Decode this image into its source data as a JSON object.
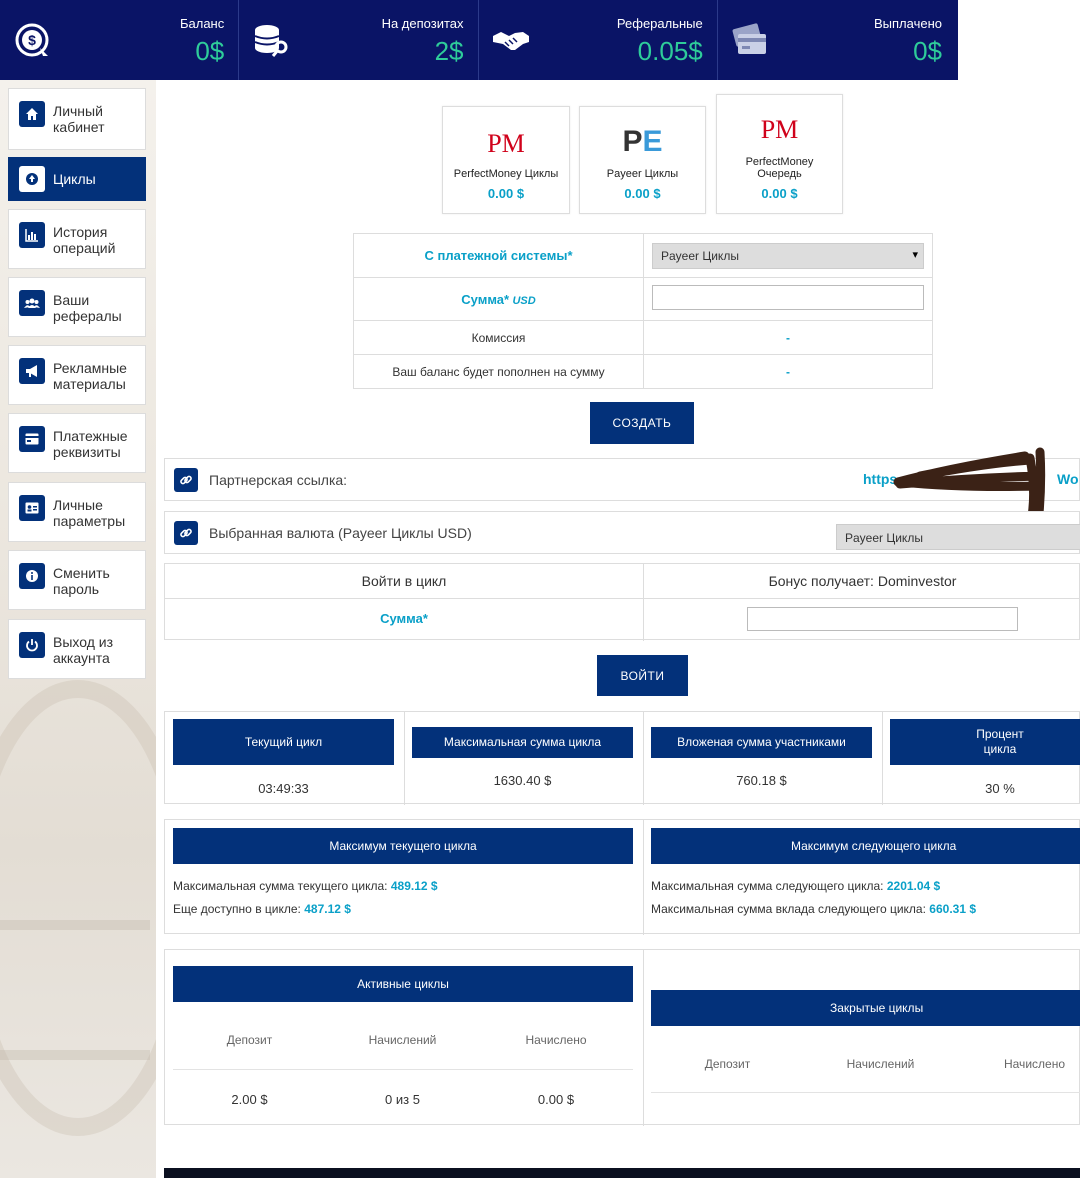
{
  "stats": [
    {
      "label": "Баланс",
      "value": "0$",
      "icon": "dollar-cycle-icon"
    },
    {
      "label": "На депозитах",
      "value": "2$",
      "icon": "coins-key-icon"
    },
    {
      "label": "Реферальные",
      "value": "0.05$",
      "icon": "handshake-icon"
    },
    {
      "label": "Выплачено",
      "value": "0$",
      "icon": "credit-card-icon"
    }
  ],
  "sidebar": {
    "items": [
      {
        "line1": "Личный",
        "line2": "кабинет",
        "icon": "home-icon"
      },
      {
        "line1": "Циклы",
        "line2": "",
        "icon": "upload-circle-icon"
      },
      {
        "line1": "История",
        "line2": "операций",
        "icon": "bar-chart-icon"
      },
      {
        "line1": "Ваши",
        "line2": "рефералы",
        "icon": "users-icon"
      },
      {
        "line1": "Рекламные",
        "line2": "материалы",
        "icon": "megaphone-icon"
      },
      {
        "line1": "Платежные",
        "line2": "реквизиты",
        "icon": "card-icon"
      },
      {
        "line1": "Личные",
        "line2": "параметры",
        "icon": "id-card-icon"
      },
      {
        "line1": "Сменить",
        "line2": "пароль",
        "icon": "info-icon"
      },
      {
        "line1": "Выход из",
        "line2": "аккаунта",
        "icon": "power-icon"
      }
    ],
    "active_index": 1
  },
  "wallets": [
    {
      "logo": "PM",
      "name_line1": "PerfectMoney Циклы",
      "name_line2": "",
      "amount": "0.00 $"
    },
    {
      "logo": "PE",
      "name_line1": "Payeer Циклы",
      "name_line2": "",
      "amount": "0.00 $"
    },
    {
      "logo": "PM",
      "name_line1": "PerfectMoney",
      "name_line2": "Очередь",
      "amount": "0.00 $"
    }
  ],
  "form": {
    "payment_system_label": "С платежной системы*",
    "payment_system_value": "Payeer Циклы",
    "amount_label": "Сумма*",
    "amount_unit": "USD",
    "commission_label": "Комиссия",
    "commission_value": "-",
    "balance_label": "Ваш баланс будет пополнен на сумму",
    "balance_value": "-",
    "create_button": "СОЗДАТЬ"
  },
  "partner": {
    "label": "Партнерская ссылка:",
    "link_visible": "https",
    "link_tail": "Wo"
  },
  "currency": {
    "label": "Выбранная валюта (Payeer Циклы USD)",
    "select_value": "Payeer Циклы"
  },
  "enter_cycle": {
    "title": "Войти в цикл",
    "bonus": "Бонус получает: Dominvestor",
    "amount_label": "Сумма*",
    "button": "ВОЙТИ"
  },
  "cycle_info": [
    {
      "header": "Текущий цикл",
      "value": "03:49:33"
    },
    {
      "header": "Максимальная сумма цикла",
      "value": "1630.40 $"
    },
    {
      "header": "Вложеная сумма участниками",
      "value": "760.18 $"
    },
    {
      "header": "Процент цикла",
      "value": "30 %"
    }
  ],
  "max_current": {
    "header": "Максимум текущего цикла",
    "line1_label": "Максимальная сумма текущего цикла:",
    "line1_value": "489.12 $",
    "line2_label": "Еще доступно в цикле:",
    "line2_value": "487.12 $"
  },
  "max_next": {
    "header": "Максимум следующего цикла",
    "line1_label": "Максимальная сумма следующего цикла:",
    "line1_value": "2201.04 $",
    "line2_label": "Максимальная сумма вклада следующего цикла:",
    "line2_value": "660.31 $"
  },
  "active_cycles": {
    "header": "Активные циклы",
    "columns": [
      "Депозит",
      "Начислений",
      "Начислено"
    ],
    "rows": [
      [
        "2.00 $",
        "0 из 5",
        "0.00 $"
      ]
    ]
  },
  "closed_cycles": {
    "header": "Закрытые циклы",
    "columns": [
      "Депозит",
      "Начислений",
      "Начислено"
    ]
  },
  "colors": {
    "navy": "#0a1466",
    "primary": "#03317a",
    "accent_green": "#2ecc9a",
    "accent_cyan": "#0aa0c8"
  }
}
